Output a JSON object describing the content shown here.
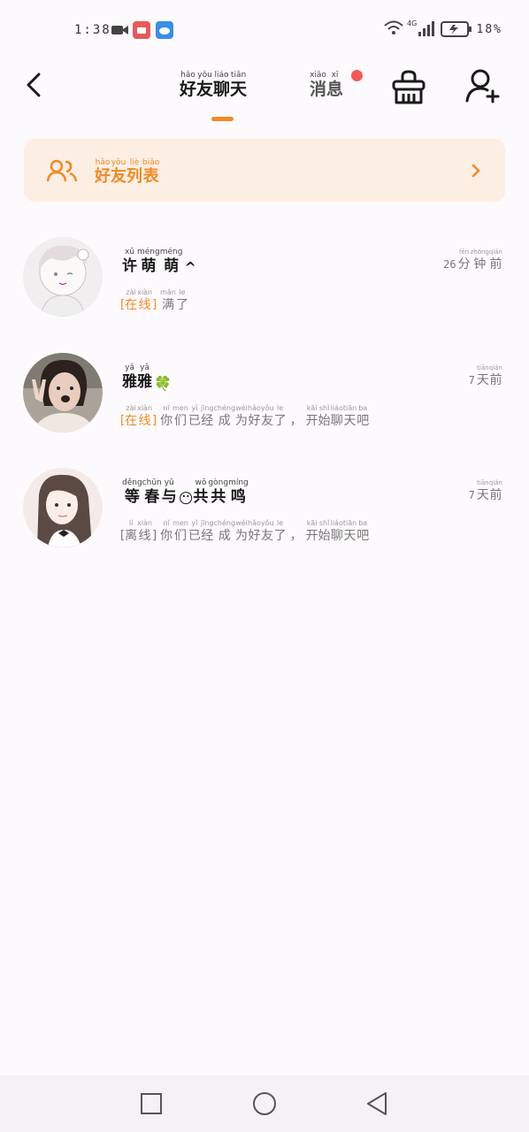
{
  "status_bar": {
    "time": "1:38",
    "network": "4G",
    "battery": "18%"
  },
  "header": {
    "tab_chat": [
      {
        "py": "hǎo",
        "hz": "好"
      },
      {
        "py": "yǒu",
        "hz": "友"
      },
      {
        "py": "liáo",
        "hz": "聊"
      },
      {
        "py": "tiān",
        "hz": "天"
      }
    ],
    "tab_messages": [
      {
        "py": "xiāo",
        "hz": "消"
      },
      {
        "py": "xī",
        "hz": "息"
      }
    ],
    "accent_color": "#f08a24",
    "badge_color": "#f05a5a"
  },
  "banner": {
    "title": [
      {
        "py": "hǎo",
        "hz": "好"
      },
      {
        "py": "yǒu",
        "hz": "友"
      },
      {
        "py": "liè",
        "hz": "列"
      },
      {
        "py": "biǎo",
        "hz": "表"
      }
    ],
    "background": "#fdeee4"
  },
  "chats": [
    {
      "name": [
        {
          "py": "xǔ",
          "hz": "许"
        },
        {
          "py": "méng",
          "hz": "萌"
        },
        {
          "py": "méng",
          "hz": "萌"
        }
      ],
      "name_suffix": "^",
      "status": [
        {
          "py": "zài",
          "hz": "在"
        },
        {
          "py": "xiàn",
          "hz": "线"
        }
      ],
      "online": true,
      "message": [
        {
          "py": "mǎn",
          "hz": "满"
        },
        {
          "py": "le",
          "hz": "了"
        }
      ],
      "time_num": "26",
      "time_unit": [
        {
          "py": "fēn",
          "hz": "分"
        },
        {
          "py": "zhōng",
          "hz": "钟"
        },
        {
          "py": "qián",
          "hz": "前"
        }
      ]
    },
    {
      "name": [
        {
          "py": "yǎ",
          "hz": "雅"
        },
        {
          "py": "yǎ",
          "hz": "雅"
        }
      ],
      "name_suffix": "🍀",
      "status": [
        {
          "py": "zài",
          "hz": "在"
        },
        {
          "py": "xiàn",
          "hz": "线"
        }
      ],
      "online": true,
      "message": [
        {
          "py": "nǐ",
          "hz": "你"
        },
        {
          "py": "men",
          "hz": "们"
        },
        {
          "py": "yǐ",
          "hz": "已"
        },
        {
          "py": "jīng",
          "hz": "经"
        },
        {
          "py": "chéng",
          "hz": "成"
        },
        {
          "py": "wéi",
          "hz": "为"
        },
        {
          "py": "hǎo",
          "hz": "好"
        },
        {
          "py": "yǒu",
          "hz": "友"
        },
        {
          "py": "le",
          "hz": "了"
        },
        {
          "punct": "，"
        },
        {
          "py": "kāi",
          "hz": "开"
        },
        {
          "py": "shǐ",
          "hz": "始"
        },
        {
          "py": "liáo",
          "hz": "聊"
        },
        {
          "py": "tiān",
          "hz": "天"
        },
        {
          "py": "ba",
          "hz": "吧"
        }
      ],
      "time_num": "7",
      "time_unit": [
        {
          "py": "tiān",
          "hz": "天"
        },
        {
          "py": "qián",
          "hz": "前"
        }
      ]
    },
    {
      "name": [
        {
          "py": "děng",
          "hz": "等"
        },
        {
          "py": "chūn",
          "hz": "春"
        },
        {
          "py": "yǔ",
          "hz": "与"
        },
        {
          "emoji": "😶"
        },
        {
          "py": "wǒ",
          "hz": "共"
        },
        {
          "py": "gòng",
          "hz": "共"
        },
        {
          "py": "míng",
          "hz": "鸣"
        }
      ],
      "name_suffix": "",
      "status": [
        {
          "py": "lí",
          "hz": "离"
        },
        {
          "py": "xiàn",
          "hz": "线"
        }
      ],
      "online": false,
      "message": [
        {
          "py": "nǐ",
          "hz": "你"
        },
        {
          "py": "men",
          "hz": "们"
        },
        {
          "py": "yǐ",
          "hz": "已"
        },
        {
          "py": "jīng",
          "hz": "经"
        },
        {
          "py": "chéng",
          "hz": "成"
        },
        {
          "py": "wéi",
          "hz": "为"
        },
        {
          "py": "hǎo",
          "hz": "好"
        },
        {
          "py": "yǒu",
          "hz": "友"
        },
        {
          "py": "le",
          "hz": "了"
        },
        {
          "punct": "，"
        },
        {
          "py": "kāi",
          "hz": "开"
        },
        {
          "py": "shǐ",
          "hz": "始"
        },
        {
          "py": "liáo",
          "hz": "聊"
        },
        {
          "py": "tiān",
          "hz": "天"
        },
        {
          "py": "ba",
          "hz": "吧"
        }
      ],
      "time_num": "7",
      "time_unit": [
        {
          "py": "tiān",
          "hz": "天"
        },
        {
          "py": "qián",
          "hz": "前"
        }
      ]
    }
  ]
}
